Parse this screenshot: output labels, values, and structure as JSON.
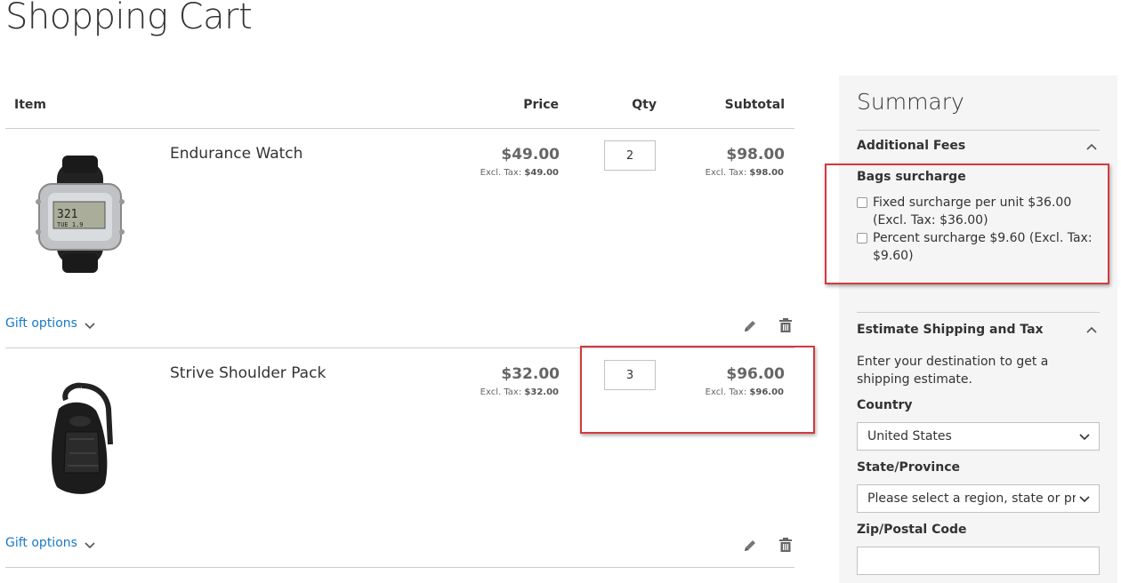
{
  "page": {
    "title": "Shopping Cart"
  },
  "cart": {
    "headers": {
      "item": "Item",
      "price": "Price",
      "qty": "Qty",
      "subtotal": "Subtotal"
    },
    "items": [
      {
        "name": "Endurance Watch",
        "price": "$49.00",
        "price_excl_label": "Excl. Tax:",
        "price_excl": "$49.00",
        "qty": "2",
        "subtotal": "$98.00",
        "subtotal_excl_label": "Excl. Tax:",
        "subtotal_excl": "$98.00",
        "gift_options": "Gift options"
      },
      {
        "name": "Strive Shoulder Pack",
        "price": "$32.00",
        "price_excl_label": "Excl. Tax:",
        "price_excl": "$32.00",
        "qty": "3",
        "subtotal": "$96.00",
        "subtotal_excl_label": "Excl. Tax:",
        "subtotal_excl": "$96.00",
        "gift_options": "Gift options"
      }
    ]
  },
  "summary": {
    "title": "Summary",
    "additional_fees": {
      "title": "Additional Fees",
      "group_title": "Bags surcharge",
      "options": [
        {
          "label": "Fixed surcharge per unit $36.00 (Excl. Tax: $36.00)",
          "checked": false
        },
        {
          "label": "Percent surcharge $9.60 (Excl. Tax: $9.60)",
          "checked": false
        }
      ]
    },
    "shipping": {
      "title": "Estimate Shipping and Tax",
      "intro": "Enter your destination to get a shipping estimate.",
      "country_label": "Country",
      "country_value": "United States",
      "state_label": "State/Province",
      "state_value": "Please select a region, state or province.",
      "zip_label": "Zip/Postal Code",
      "zip_value": ""
    }
  },
  "colors": {
    "link": "#1979c3",
    "highlight": "#d43a3f",
    "summary_bg": "#f5f5f5"
  }
}
